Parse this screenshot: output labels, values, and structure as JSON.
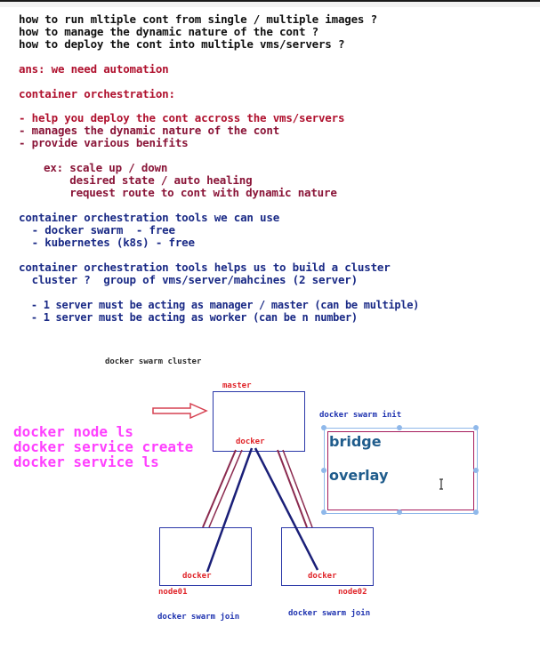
{
  "notes": {
    "questions": [
      "how to run mltiple cont from single / multiple images ?",
      "how to manage the dynamic nature of the cont ?",
      "how to deploy the cont into multiple vms/servers ?"
    ],
    "answer": "ans: we need automation",
    "orchestration_title": "container orchestration:",
    "orchestration_points": [
      "- help you deploy the cont accross the vms/servers",
      "- manages the dynamic nature of the cont",
      "- provide various benifits"
    ],
    "examples": [
      "ex: scale up / down",
      "    desired state / auto healing",
      "    request route to cont with dynamic nature"
    ],
    "tools_title": "container orchestration tools we can use",
    "tools": [
      "  - docker swarm  - free",
      "  - kubernetes (k8s) - free"
    ],
    "cluster_lines": [
      "container orchestration tools helps us to build a cluster",
      "  cluster ?  group of vms/server/mahcines (2 server)"
    ],
    "server_points": [
      "  - 1 server must be acting as manager / master (can be multiple)",
      "  - 1 server must be acting as worker (can be n number)"
    ]
  },
  "diagram": {
    "cluster_label": "docker swarm cluster",
    "master_label": "master",
    "master_docker": "docker",
    "node01_docker": "docker",
    "node02_docker": "docker",
    "node01_label": "node01",
    "node02_label": "node02",
    "join_left": "docker swarm join",
    "join_right": "docker swarm join",
    "init_label": "docker swarm init",
    "network_bridge": "bridge",
    "network_overlay": "overlay",
    "commands": [
      "docker node ls",
      "docker service create",
      "docker service ls"
    ]
  },
  "colors": {
    "question_text": "#111111",
    "answer_text": "#b0122f",
    "orchestration_text": "#8a1538",
    "tools_text": "#1a2a86",
    "commands_text": "#ff40ff",
    "box_border": "#2a37a8",
    "network_box_border": "#a51c5c",
    "network_text": "#1f5c8c"
  },
  "icons": {
    "arrow": "right-hollow-arrow-icon",
    "cursor": "text-cursor-icon"
  }
}
